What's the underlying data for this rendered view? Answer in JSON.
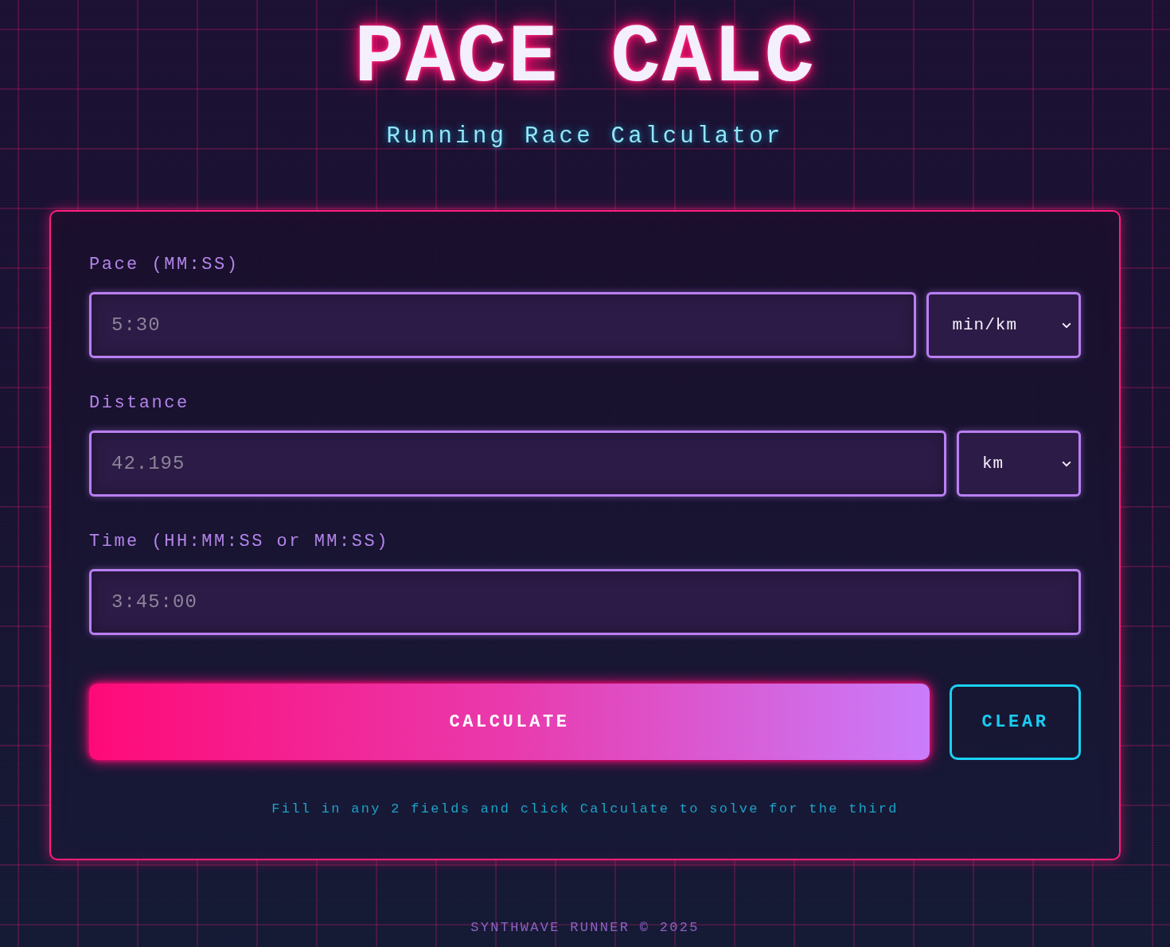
{
  "header": {
    "title": "PACE CALC",
    "subtitle": "Running Race Calculator"
  },
  "form": {
    "fields": [
      {
        "label": "Pace (MM:SS)",
        "placeholder": "5:30",
        "unit": "min/km"
      },
      {
        "label": "Distance",
        "placeholder": "42.195",
        "unit": "km"
      },
      {
        "label": "Time (HH:MM:SS or MM:SS)",
        "placeholder": "3:45:00"
      }
    ],
    "buttons": [
      {
        "label": "CALCULATE",
        "kind": "primary"
      },
      {
        "label": "CLEAR",
        "kind": "secondary"
      }
    ],
    "hint": "Fill in any 2 fields and click Calculate to solve for the third"
  },
  "footer": "SYNTHWAVE RUNNER © 2025"
}
